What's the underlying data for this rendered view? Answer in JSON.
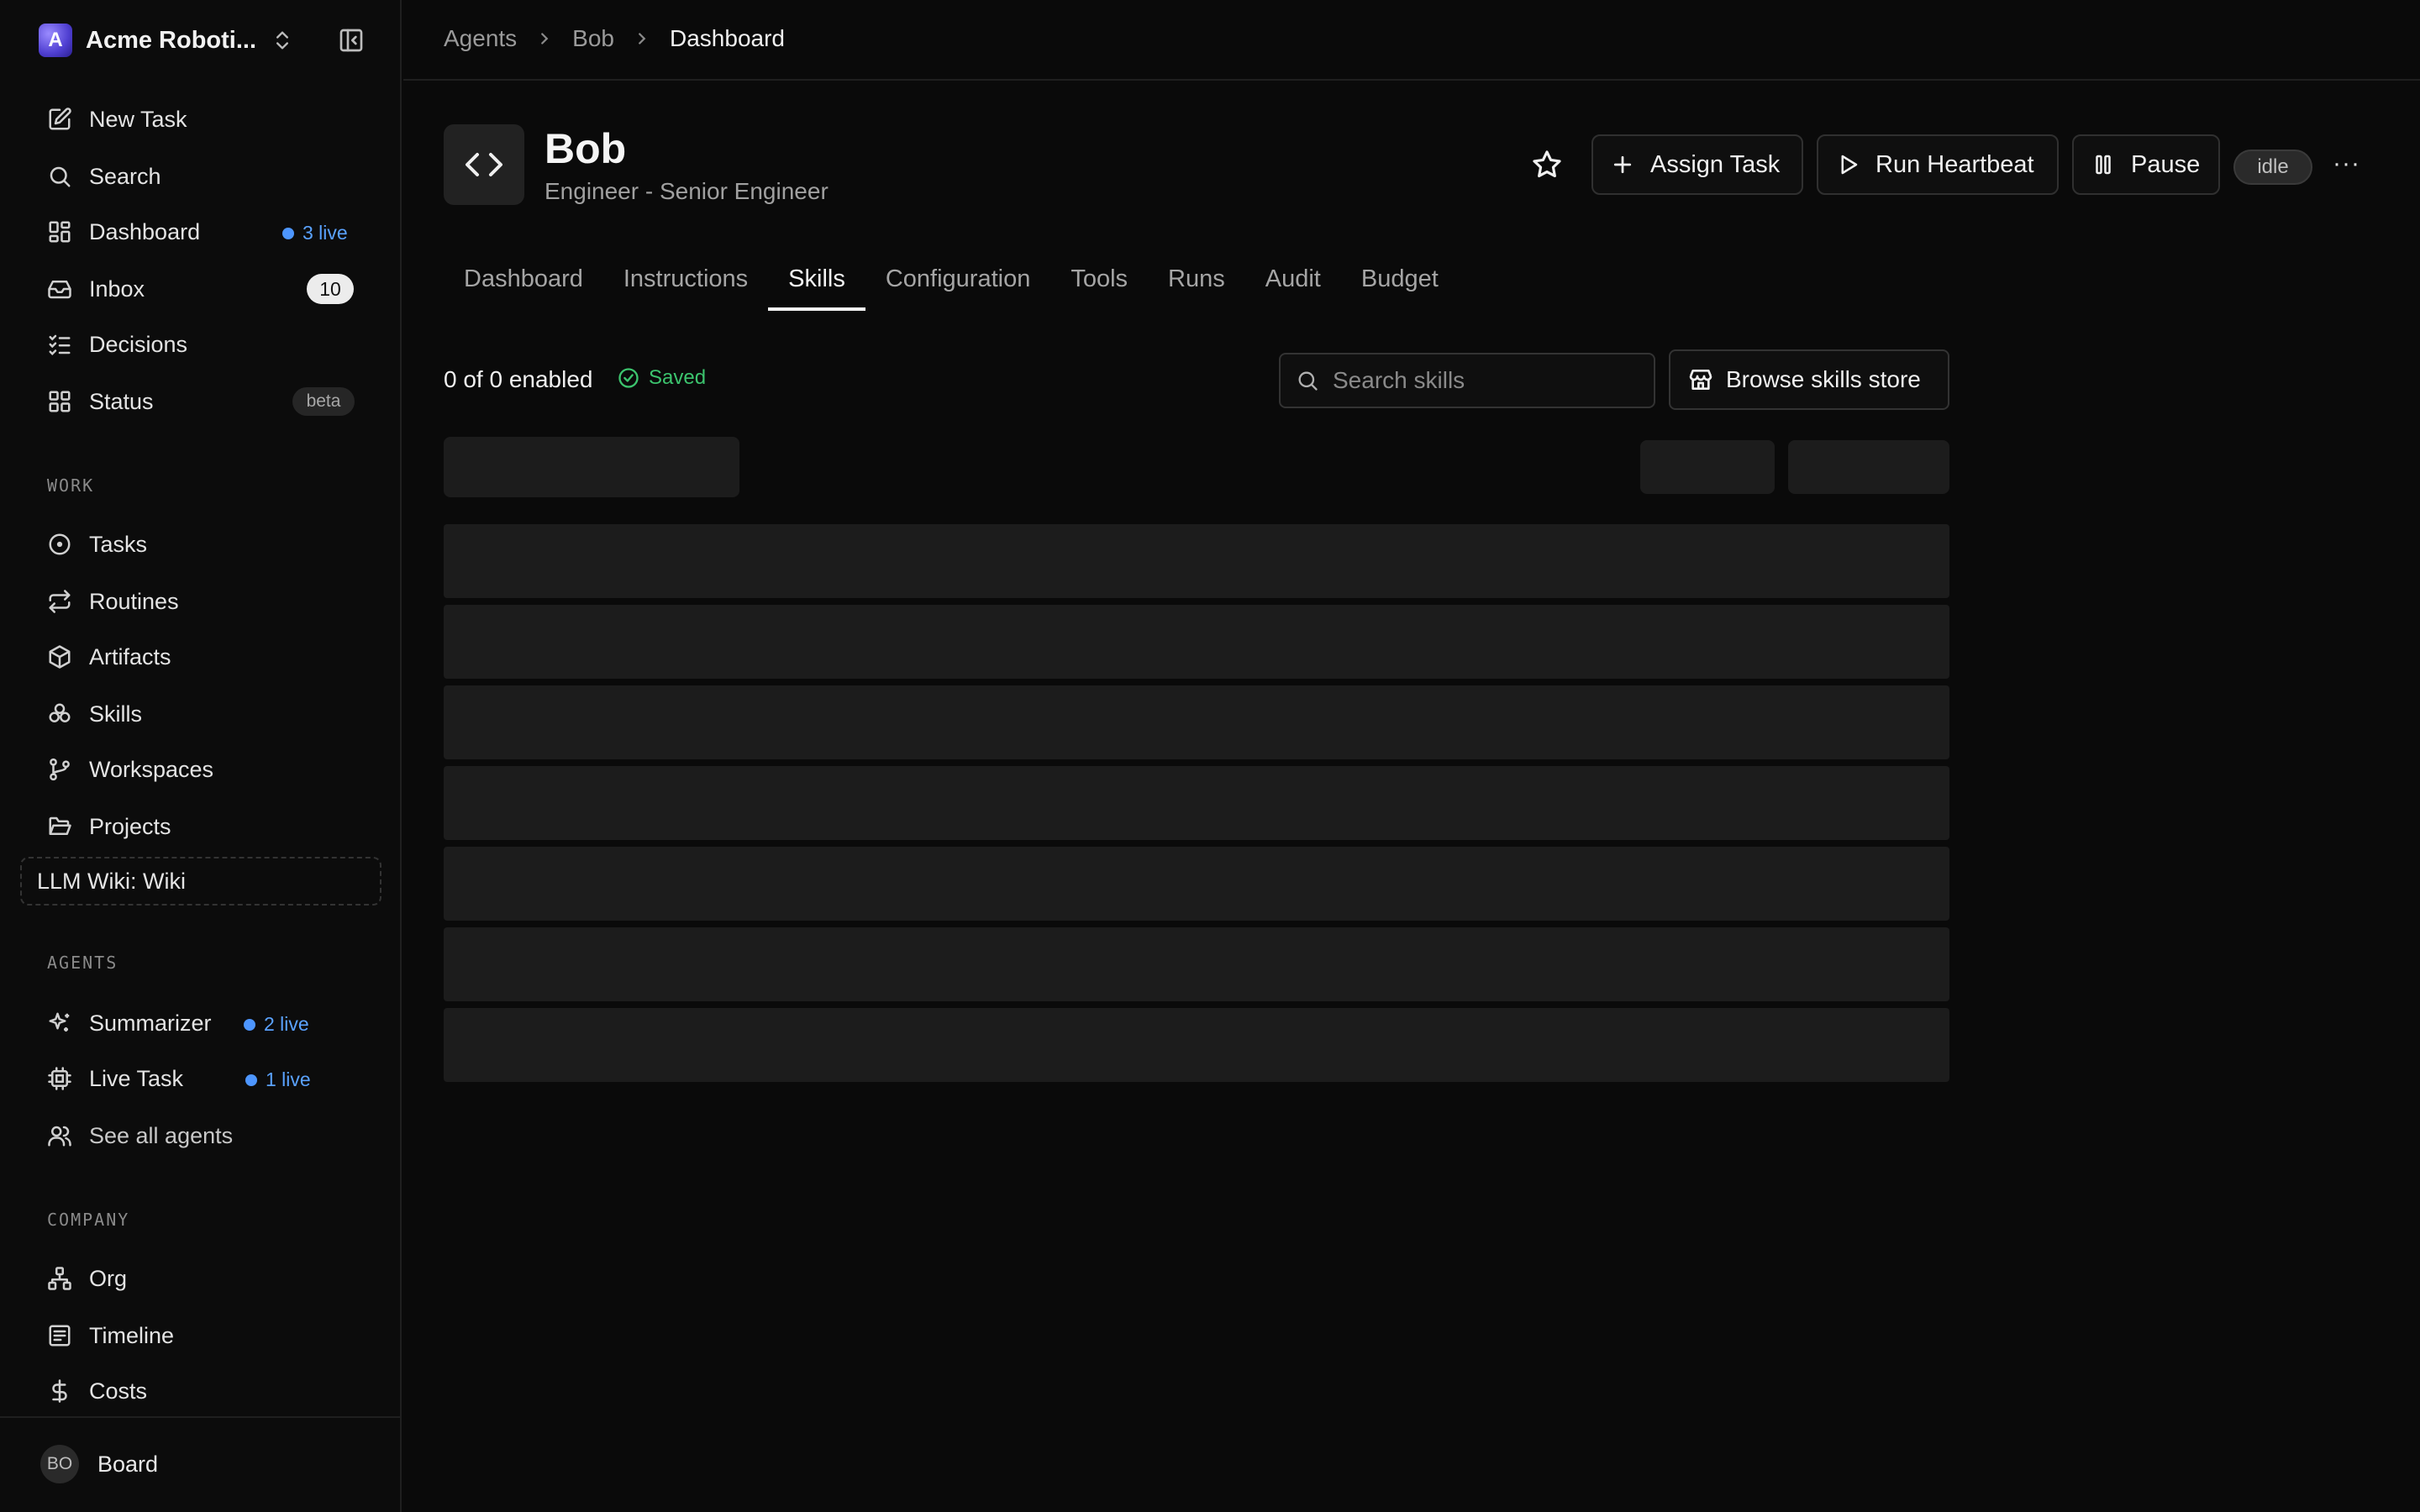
{
  "sidebar": {
    "company": {
      "logo_letter": "A",
      "name": "Acme Roboti..."
    },
    "items": [
      {
        "label": "New Task"
      },
      {
        "label": "Search"
      },
      {
        "label": "Dashboard",
        "live": "3 live"
      },
      {
        "label": "Inbox",
        "count": "10"
      },
      {
        "label": "Decisions"
      },
      {
        "label": "Status",
        "badge": "beta"
      }
    ],
    "work_label": "WORK",
    "work_items": [
      {
        "label": "Tasks"
      },
      {
        "label": "Routines"
      },
      {
        "label": "Artifacts"
      },
      {
        "label": "Skills"
      },
      {
        "label": "Workspaces"
      },
      {
        "label": "Projects"
      }
    ],
    "wiki_label": "LLM Wiki: Wiki",
    "agents_label": "AGENTS",
    "agent_items": [
      {
        "label": "Summarizer",
        "live": "2 live"
      },
      {
        "label": "Live Task",
        "live": "1 live"
      },
      {
        "label": "See all agents"
      }
    ],
    "company_label": "COMPANY",
    "company_items": [
      {
        "label": "Org"
      },
      {
        "label": "Timeline"
      },
      {
        "label": "Costs"
      }
    ],
    "footer": {
      "initials": "BO",
      "name": "Board"
    }
  },
  "breadcrumb": [
    "Agents",
    "Bob",
    "Dashboard"
  ],
  "agent": {
    "name": "Bob",
    "role": "Engineer - Senior Engineer",
    "status": "idle"
  },
  "actions": {
    "assign": "Assign Task",
    "heartbeat": "Run Heartbeat",
    "pause": "Pause",
    "more": "···"
  },
  "tabs": [
    "Dashboard",
    "Instructions",
    "Skills",
    "Configuration",
    "Tools",
    "Runs",
    "Audit",
    "Budget"
  ],
  "active_tab": "Skills",
  "skills": {
    "enabled_text": "0 of 0 enabled",
    "saved_label": "Saved",
    "search_placeholder": "Search skills",
    "browse_label": "Browse skills store"
  },
  "colors": {
    "accent_live": "#4d96ff",
    "saved_green": "#3cc46e",
    "background": "#0a0a0a"
  }
}
